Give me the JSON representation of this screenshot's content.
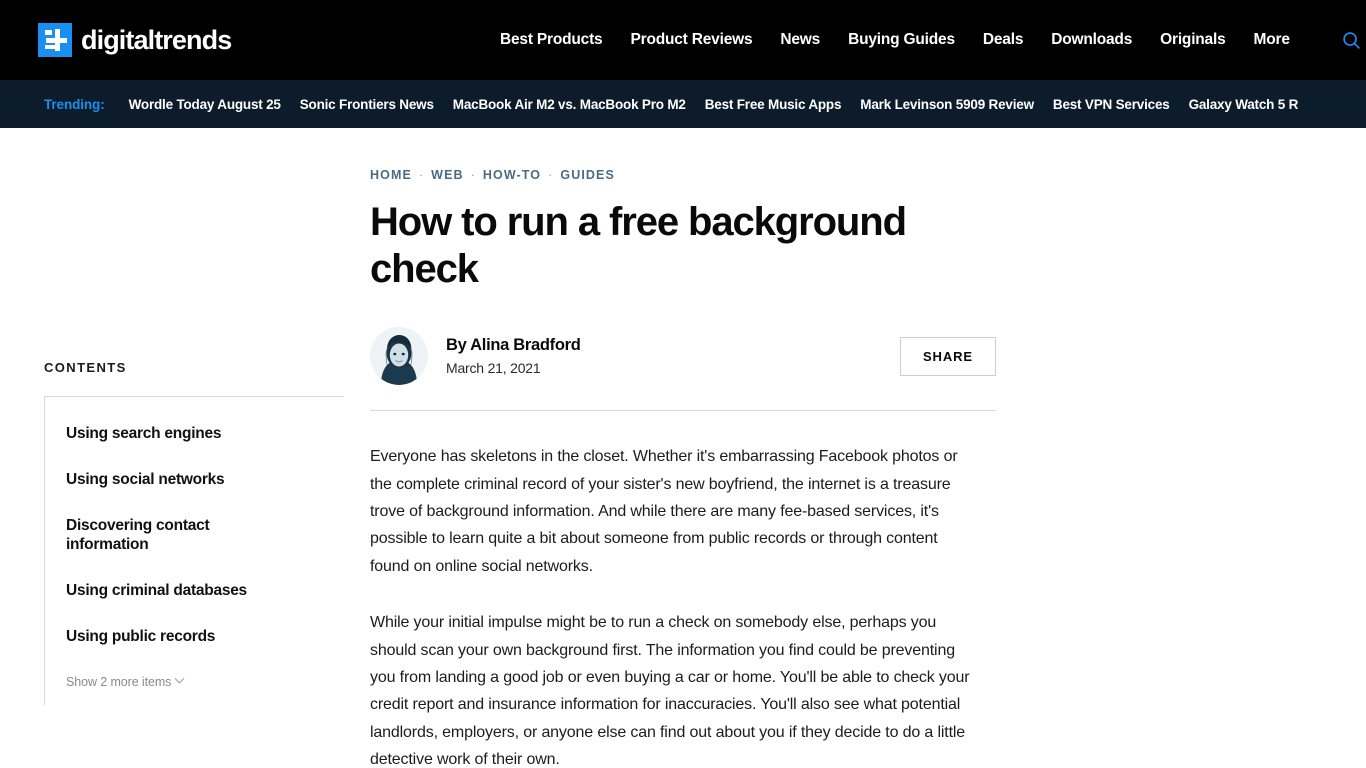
{
  "header": {
    "logo_text": "digitaltrends",
    "logo_icon": "plus-square-icon",
    "nav": [
      {
        "label": "Best Products"
      },
      {
        "label": "Product Reviews"
      },
      {
        "label": "News"
      },
      {
        "label": "Buying Guides"
      },
      {
        "label": "Deals"
      },
      {
        "label": "Downloads"
      },
      {
        "label": "Originals"
      },
      {
        "label": "More"
      }
    ],
    "search_icon": "search-icon",
    "bg_color": "#000000",
    "accent_color": "#1b8ef2"
  },
  "trending": {
    "label": "Trending:",
    "bg_color": "#0d1c2b",
    "items": [
      {
        "label": "Wordle Today August 25"
      },
      {
        "label": "Sonic Frontiers News"
      },
      {
        "label": "MacBook Air M2 vs. MacBook Pro M2"
      },
      {
        "label": "Best Free Music Apps"
      },
      {
        "label": "Mark Levinson 5909 Review"
      },
      {
        "label": "Best VPN Services"
      },
      {
        "label": "Galaxy Watch 5 R"
      }
    ]
  },
  "sidebar": {
    "heading": "CONTENTS",
    "items": [
      {
        "label": "Using search engines"
      },
      {
        "label": "Using social networks"
      },
      {
        "label": "Discovering contact information"
      },
      {
        "label": "Using criminal databases"
      },
      {
        "label": "Using public records"
      }
    ],
    "show_more": "Show 2 more items",
    "show_more_icon": "chevron-down-icon"
  },
  "article": {
    "breadcrumb": [
      {
        "label": "HOME"
      },
      {
        "label": "WEB"
      },
      {
        "label": "HOW-TO"
      },
      {
        "label": "GUIDES"
      }
    ],
    "breadcrumb_separator": "·",
    "title": "How to run a free background check",
    "author": "By Alina Bradford",
    "date": "March 21, 2021",
    "avatar_icon": "author-avatar",
    "share_label": "SHARE",
    "paragraphs": [
      "Everyone has skeletons in the closet. Whether it's embarrassing Facebook photos or the complete criminal record of your sister's new boyfriend, the internet is a treasure trove of background information. And while there are many fee-based services, it's possible to learn quite a bit about someone from public records or through content found on online social networks.",
      "While your initial impulse might be to run a check on somebody else, perhaps you should scan your own background first. The information you find could be preventing you from landing a good job or even buying a car or home. You'll be able to check your credit report and insurance information for inaccuracies. You'll also see what potential landlords, employers, or anyone else can find out about you if they decide to do a little detective work of their own."
    ]
  }
}
